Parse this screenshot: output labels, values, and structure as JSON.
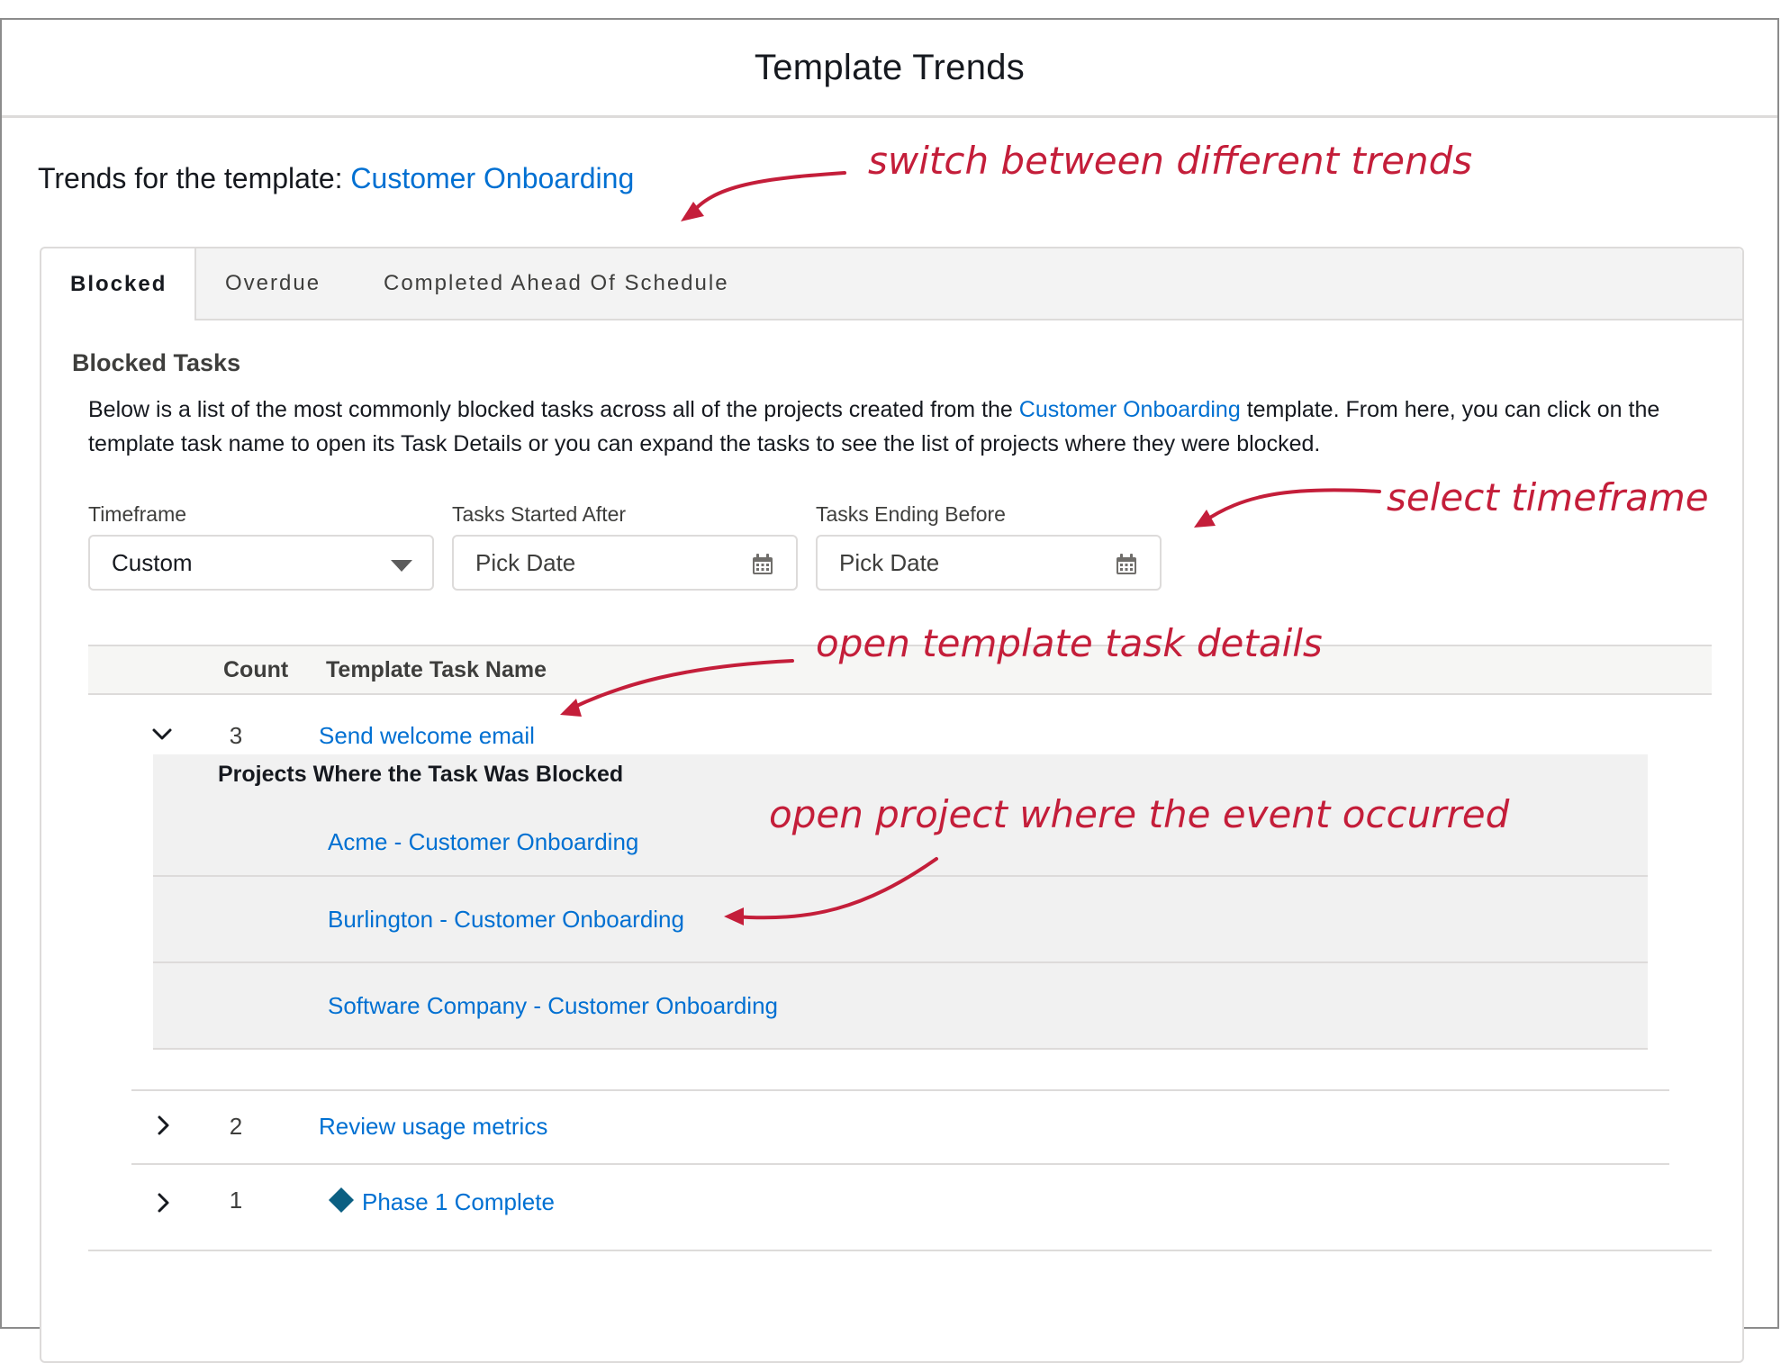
{
  "modal": {
    "title": "Template Trends"
  },
  "template": {
    "prefix": "Trends for the template:",
    "name": "Customer Onboarding"
  },
  "tabs": [
    {
      "label": "Blocked",
      "active": true
    },
    {
      "label": "Overdue",
      "active": false
    },
    {
      "label": "Completed Ahead Of Schedule",
      "active": false
    }
  ],
  "section": {
    "title": "Blocked Tasks",
    "desc_before": "Below is a list of the most commonly blocked tasks across all of the projects created from the",
    "desc_link": "Customer Onboarding",
    "desc_after": "template. From here, you can click on the template task name to open its Task Details or you can expand the tasks to see the list of projects where they were blocked."
  },
  "filters": {
    "timeframe_label": "Timeframe",
    "timeframe_value": "Custom",
    "started_label": "Tasks Started After",
    "started_placeholder": "Pick Date",
    "ending_label": "Tasks Ending Before",
    "ending_placeholder": "Pick Date"
  },
  "table": {
    "col_count": "Count",
    "col_name": "Template Task Name",
    "rows": [
      {
        "count": "3",
        "name": "Send welcome email",
        "expanded": true
      },
      {
        "count": "2",
        "name": "Review usage metrics",
        "expanded": false
      },
      {
        "count": "1",
        "name": "Phase 1 Complete",
        "expanded": false,
        "milestone": true
      }
    ],
    "subtable": {
      "title": "Projects Where the Task Was Blocked",
      "projects": [
        "Acme - Customer Onboarding",
        "Burlington - Customer Onboarding",
        "Software Company - Customer Onboarding"
      ]
    }
  },
  "annotations": {
    "tabs": "switch between different trends",
    "timeframe": "select timeframe",
    "task_details": "open template task details",
    "project": "open project where the event occurred"
  },
  "colors": {
    "link": "#0070d2",
    "annotation": "#c41e3a",
    "milestone": "#0b5f82"
  }
}
